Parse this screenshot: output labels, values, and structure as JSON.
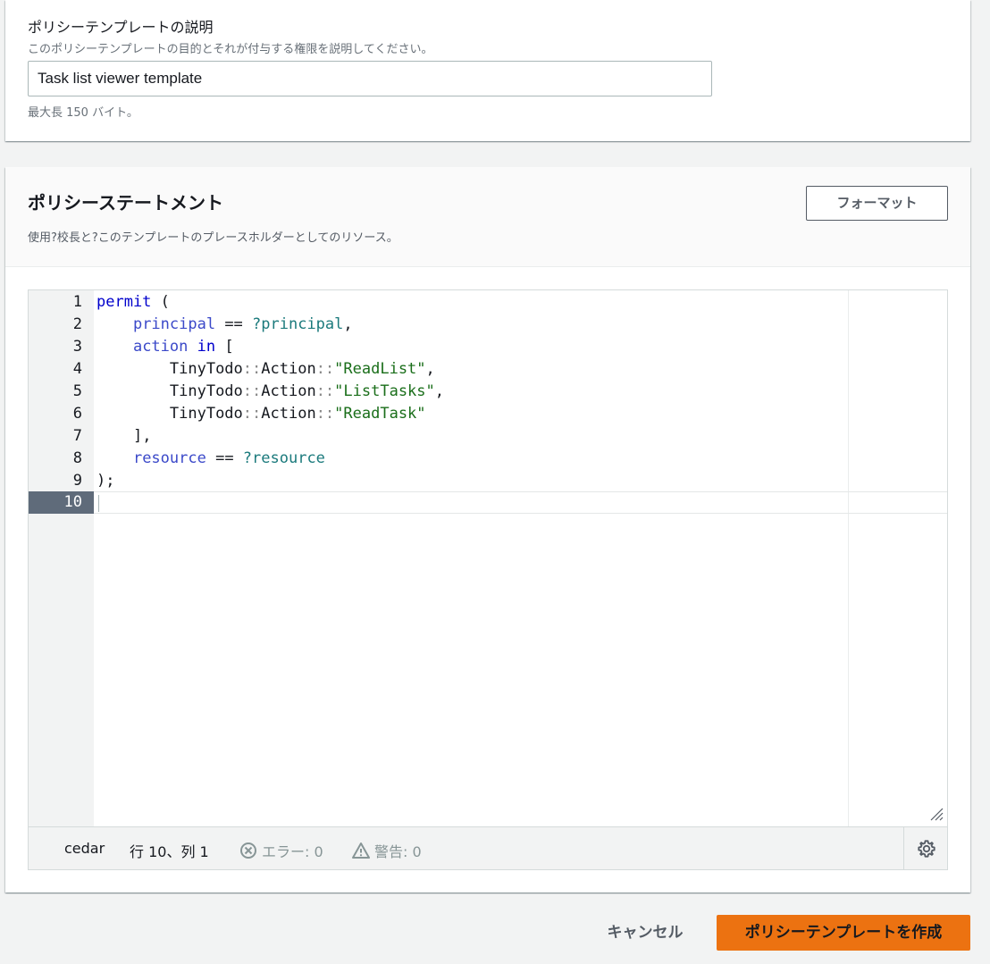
{
  "description_section": {
    "label": "ポリシーテンプレートの説明",
    "hint": "このポリシーテンプレートの目的とそれが付与する権限を説明してください。",
    "value": "Task list viewer template",
    "constraint": "最大長 150 バイト。"
  },
  "statement_section": {
    "title": "ポリシーステートメント",
    "description": "使用?校長と?このテンプレートのプレースホルダーとしてのリソース。",
    "format_button": "フォーマット"
  },
  "editor": {
    "line_numbers": [
      "1",
      "2",
      "3",
      "4",
      "5",
      "6",
      "7",
      "8",
      "9",
      "10"
    ],
    "active_line": "10",
    "code": {
      "l1_kw": "permit",
      "l1_rest": " (",
      "l2_var": "principal",
      "l2_op": " == ",
      "l2_slot": "?principal",
      "l2_end": ",",
      "l3_var": "action",
      "l3_kw": "in",
      "l3_end": " [",
      "l4_ns": "TinyTodo",
      "l4_type": "Action",
      "l4_str": "\"ReadList\"",
      "l4_end": ",",
      "l5_ns": "TinyTodo",
      "l5_type": "Action",
      "l5_str": "\"ListTasks\"",
      "l5_end": ",",
      "l6_ns": "TinyTodo",
      "l6_type": "Action",
      "l6_str": "\"ReadTask\"",
      "l7": "],",
      "l8_var": "resource",
      "l8_op": " == ",
      "l8_slot": "?resource",
      "l9": ");"
    },
    "status": {
      "language": "cedar",
      "position": "行 10、列 1",
      "errors": "エラー: 0",
      "warnings": "警告: 0"
    }
  },
  "actions": {
    "cancel": "キャンセル",
    "create": "ポリシーテンプレートを作成"
  },
  "colors": {
    "primary_button": "#ec7211",
    "page_background": "#f2f3f3"
  }
}
